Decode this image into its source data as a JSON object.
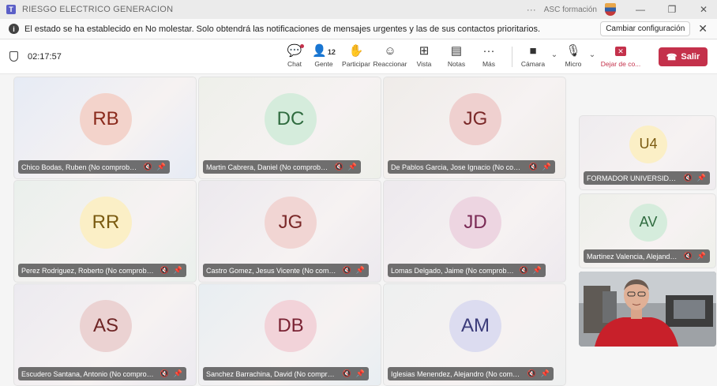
{
  "window": {
    "title": "RIESGO ELECTRICO GENERACION",
    "org": "ASC formación",
    "more": "···",
    "minimize": "—",
    "restore": "❐",
    "close": "✕"
  },
  "banner": {
    "message": "El estado se ha establecido en No molestar. Solo obtendrá las notificaciones de mensajes urgentes y las de sus contactos prioritarios.",
    "button": "Cambiar configuración",
    "close": "✕"
  },
  "toolbar": {
    "timer": "02:17:57",
    "items": [
      {
        "label": "Chat",
        "icon": "chat-icon",
        "glyph": "💬"
      },
      {
        "label": "Gente",
        "icon": "people-icon",
        "glyph": "👤",
        "count": "12"
      },
      {
        "label": "Participar",
        "icon": "raise-hand-icon",
        "glyph": "✋"
      },
      {
        "label": "Reaccionar",
        "icon": "smiley-icon",
        "glyph": "☺"
      },
      {
        "label": "Vista",
        "icon": "grid-icon",
        "glyph": "⊞"
      },
      {
        "label": "Notas",
        "icon": "notes-icon",
        "glyph": "▤"
      },
      {
        "label": "Más",
        "icon": "more-icon",
        "glyph": "···"
      }
    ],
    "camera": {
      "label": "Cámara",
      "glyph": "■"
    },
    "mic": {
      "label": "Micro",
      "glyph": "🎙"
    },
    "chevron": "⌄",
    "leave": {
      "label": "Dejar de co...",
      "glyph": "✕"
    },
    "salir": {
      "label": "Salir",
      "glyph": "☎"
    }
  },
  "icons": {
    "mic_off": "🔇",
    "pin": "📌"
  },
  "participants": [
    {
      "initials": "RB",
      "name": "Chico Bodas, Ruben (No comprobado)",
      "avatar_bg": "#f3d3cb",
      "avatar_fg": "#8a2a1c",
      "tile_bg": "#e6ebf5"
    },
    {
      "initials": "DC",
      "name": "Martin Cabrera, Daniel (No comprobado)",
      "avatar_bg": "#d5ecdc",
      "avatar_fg": "#2f6b3f",
      "tile_bg": "#eef0ea"
    },
    {
      "initials": "JG",
      "name": "De Pablos Garcia, Jose Ignacio (No compr...",
      "avatar_bg": "#efd0cf",
      "avatar_fg": "#7a2828",
      "tile_bg": "#efece9"
    },
    {
      "initials": "RR",
      "name": "Perez Rodriguez, Roberto (No comprobad...",
      "avatar_bg": "#fbefc6",
      "avatar_fg": "#7a5a10",
      "tile_bg": "#eaf0ec"
    },
    {
      "initials": "JG",
      "name": "Castro Gomez, Jesus Vicente (No compro...",
      "avatar_bg": "#f1d5d3",
      "avatar_fg": "#7a2828",
      "tile_bg": "#ece9ee"
    },
    {
      "initials": "JD",
      "name": "Lomas Delgado, Jaime (No comprobado)",
      "avatar_bg": "#edd5e1",
      "avatar_fg": "#7a2a55",
      "tile_bg": "#ede9ee"
    },
    {
      "initials": "AS",
      "name": "Escudero Santana, Antonio (No comprob...",
      "avatar_bg": "#ebd2d2",
      "avatar_fg": "#6e2424",
      "tile_bg": "#eceaf0"
    },
    {
      "initials": "DB",
      "name": "Sanchez Barrachina, David (No comproba...",
      "avatar_bg": "#f2d3d9",
      "avatar_fg": "#7a2233",
      "tile_bg": "#e8eef2"
    },
    {
      "initials": "AM",
      "name": "Iglesias Menendez, Alejandro (No compro...",
      "avatar_bg": "#dcdcf0",
      "avatar_fg": "#3b3b7a",
      "tile_bg": "#eef0f0"
    }
  ],
  "side": [
    {
      "initials": "U4",
      "name": "FORMADOR UNIVERSIDAD CO...",
      "avatar_bg": "#fbefc6",
      "avatar_fg": "#7a5a10",
      "tile_bg": "#efecef"
    },
    {
      "initials": "AV",
      "name": "Martinez Valencia, Alejandro (N...",
      "avatar_bg": "#d5ecdc",
      "avatar_fg": "#2f6b3f",
      "tile_bg": "#eef0ea"
    }
  ]
}
